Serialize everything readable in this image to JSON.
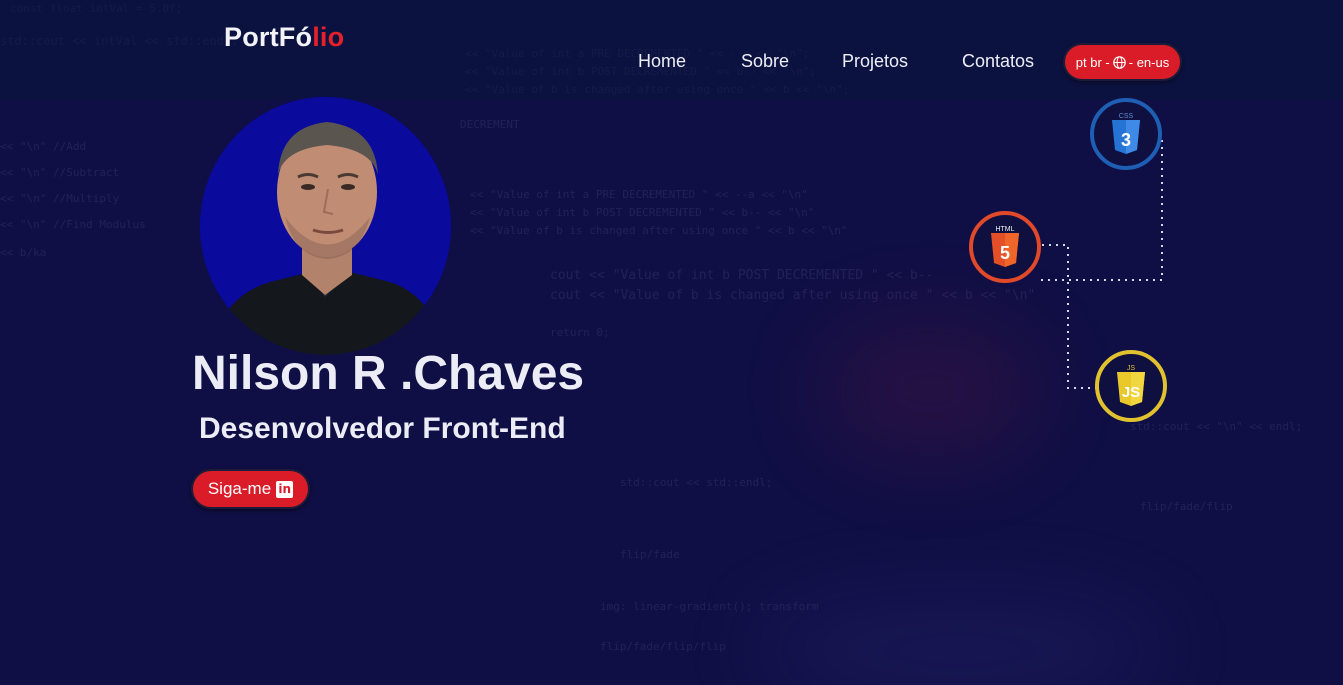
{
  "header": {
    "logo_part1": "PortFó",
    "logo_part2": "lio",
    "nav": [
      {
        "label": "Home"
      },
      {
        "label": "Sobre"
      },
      {
        "label": "Projetos"
      },
      {
        "label": "Contatos"
      }
    ],
    "lang_toggle": {
      "left": "pt br -",
      "right": "- en-us"
    }
  },
  "hero": {
    "name": "Nilson R .Chaves",
    "role": "Desenvolvedor Front-End",
    "follow_label": "Siga-me"
  },
  "tech_badges": [
    {
      "label": "3",
      "name": "css3-icon",
      "color": "#1e5fb4"
    },
    {
      "label": "5",
      "name": "html5-icon",
      "color": "#e0492a"
    },
    {
      "label": "JS",
      "name": "javascript-icon",
      "color": "#e0c12f"
    }
  ],
  "colors": {
    "background": "#100f45",
    "accent": "#d91c28",
    "logo_accent": "#e3212b"
  }
}
